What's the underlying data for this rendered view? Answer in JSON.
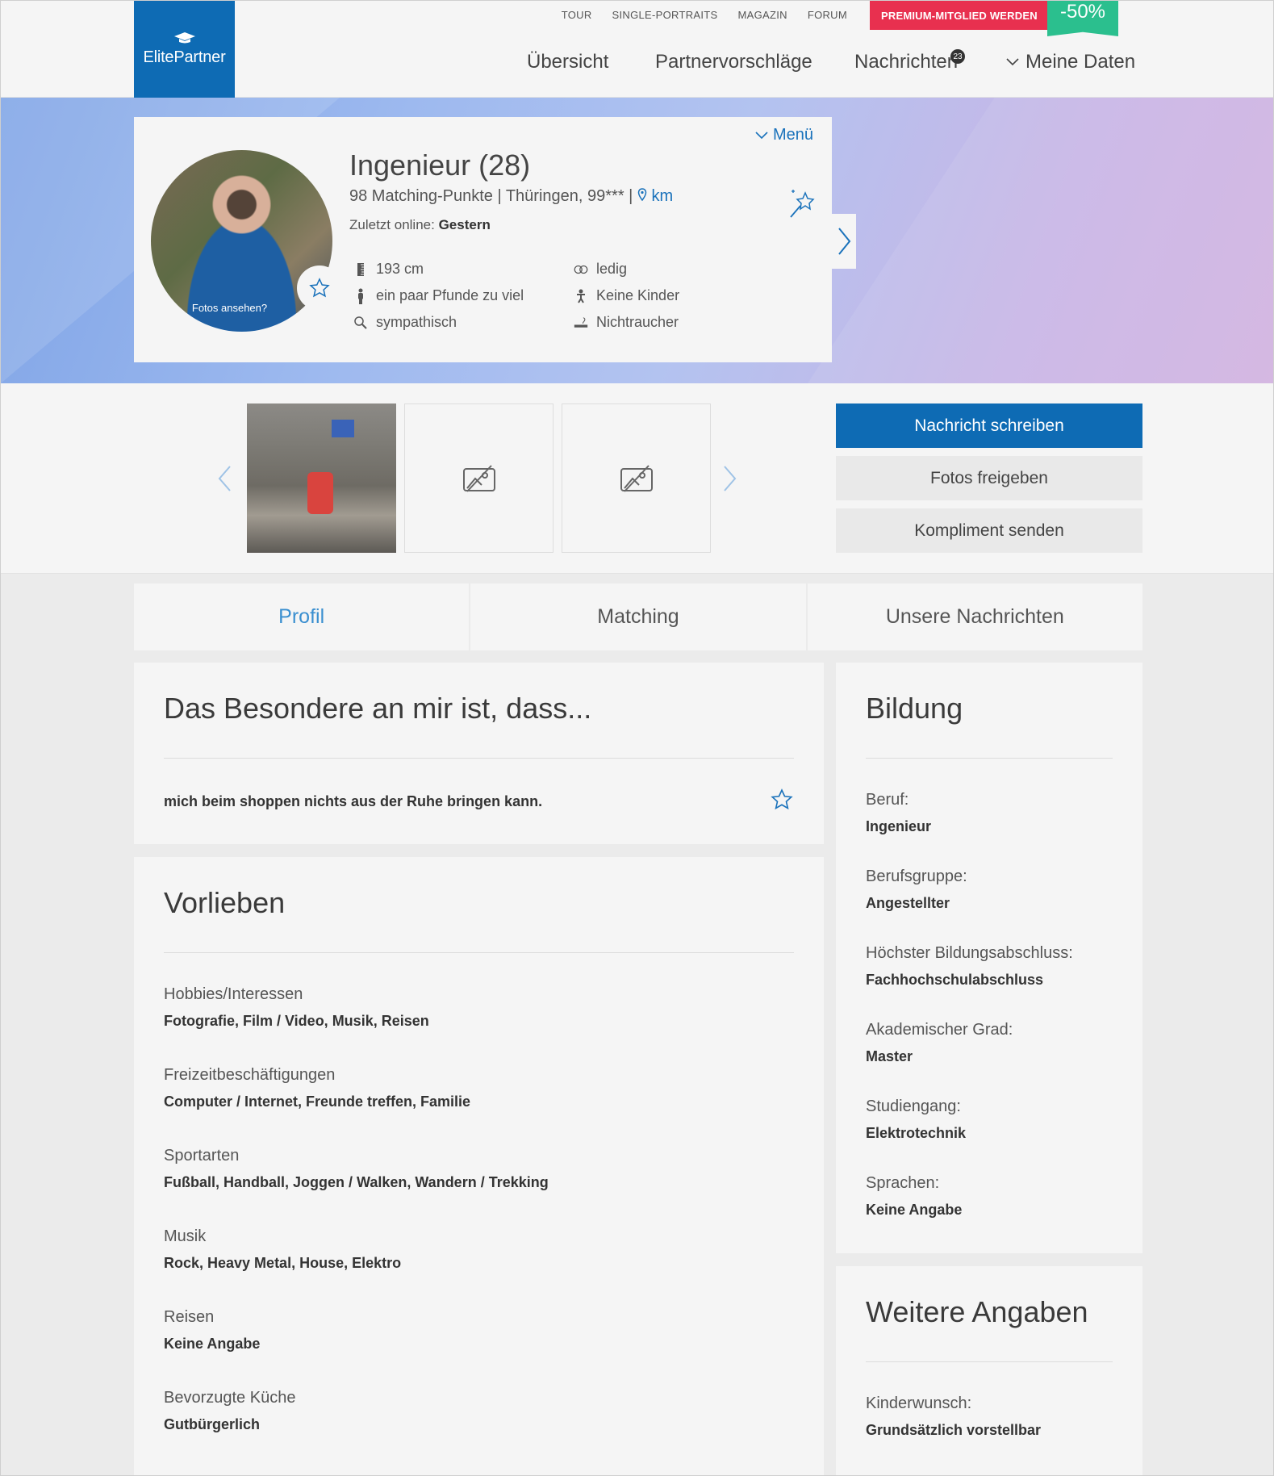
{
  "header": {
    "logo_text": "ElitePartner",
    "top_links": [
      "TOUR",
      "SINGLE-PORTRAITS",
      "MAGAZIN",
      "FORUM"
    ],
    "premium_label": "PREMIUM-MITGLIED WERDEN",
    "discount": "-50%",
    "nav": {
      "uebersicht": "Übersicht",
      "partnervorschlaege": "Partnervorschläge",
      "nachrichten": "Nachrichten",
      "nachrichten_count": "23",
      "meine_daten": "Meine Daten"
    }
  },
  "profile": {
    "menu_label": "Menü",
    "name": "Ingenieur (28)",
    "meta_prefix": "98 Matching-Punkte | Thüringen, 99*** |",
    "km": "km",
    "online_label": "Zuletzt online:",
    "online_value": "Gestern",
    "photo_hint": "Fotos ansehen?",
    "attributes": {
      "height": "193 cm",
      "figure": "ein paar Pfunde zu viel",
      "look": "sympathisch",
      "status": "ledig",
      "children": "Keine Kinder",
      "smoking": "Nichtraucher"
    }
  },
  "actions": {
    "write": "Nachricht schreiben",
    "photos": "Fotos freigeben",
    "compliment": "Kompliment senden"
  },
  "tabs": [
    "Profil",
    "Matching",
    "Unsere Nachrichten"
  ],
  "special": {
    "title": "Das Besondere an mir ist, dass...",
    "text": "mich beim shoppen nichts aus der Ruhe bringen kann."
  },
  "vorlieben": {
    "title": "Vorlieben",
    "items": [
      {
        "label": "Hobbies/Interessen",
        "value": "Fotografie, Film / Video, Musik, Reisen"
      },
      {
        "label": "Freizeitbeschäftigungen",
        "value": "Computer / Internet, Freunde treffen, Familie"
      },
      {
        "label": "Sportarten",
        "value": "Fußball, Handball, Joggen / Walken, Wandern / Trekking"
      },
      {
        "label": "Musik",
        "value": "Rock, Heavy Metal, House, Elektro"
      },
      {
        "label": "Reisen",
        "value": "Keine Angabe"
      },
      {
        "label": "Bevorzugte Küche",
        "value": "Gutbürgerlich"
      }
    ]
  },
  "bildung": {
    "title": "Bildung",
    "items": [
      {
        "label": "Beruf:",
        "value": "Ingenieur"
      },
      {
        "label": "Berufsgruppe:",
        "value": "Angestellter"
      },
      {
        "label": "Höchster Bildungsabschluss:",
        "value": "Fachhochschulabschluss"
      },
      {
        "label": "Akademischer Grad:",
        "value": "Master"
      },
      {
        "label": "Studiengang:",
        "value": "Elektrotechnik"
      },
      {
        "label": "Sprachen:",
        "value": "Keine Angabe"
      }
    ]
  },
  "weitere": {
    "title": "Weitere Angaben",
    "items": [
      {
        "label": "Kinderwunsch:",
        "value": "Grundsätzlich vorstellbar"
      }
    ]
  },
  "colors": {
    "brand_blue": "#0e6bb4",
    "premium_red": "#e8304f",
    "discount_green": "#2bbf8e",
    "link_blue": "#1a72bb"
  }
}
